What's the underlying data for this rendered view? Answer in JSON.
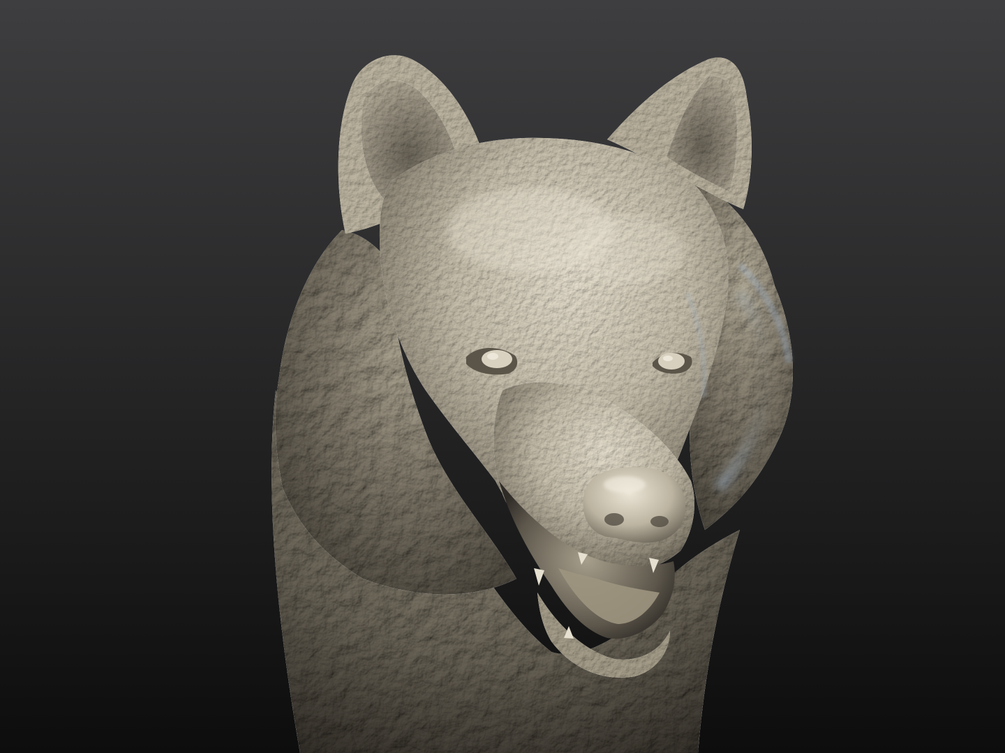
{
  "scene": {
    "subject": "wolf-head-sculpt",
    "colors": {
      "background_top": "#3e3e40",
      "background_bottom": "#0d0d0d",
      "material_light": "#e4ddcc",
      "material_mid": "#b3ab98",
      "material_dark": "#554f45",
      "material_shadow": "#2b2824",
      "mouth_cavity": "#3a342d",
      "rim_light": "#9fb3c8"
    }
  }
}
